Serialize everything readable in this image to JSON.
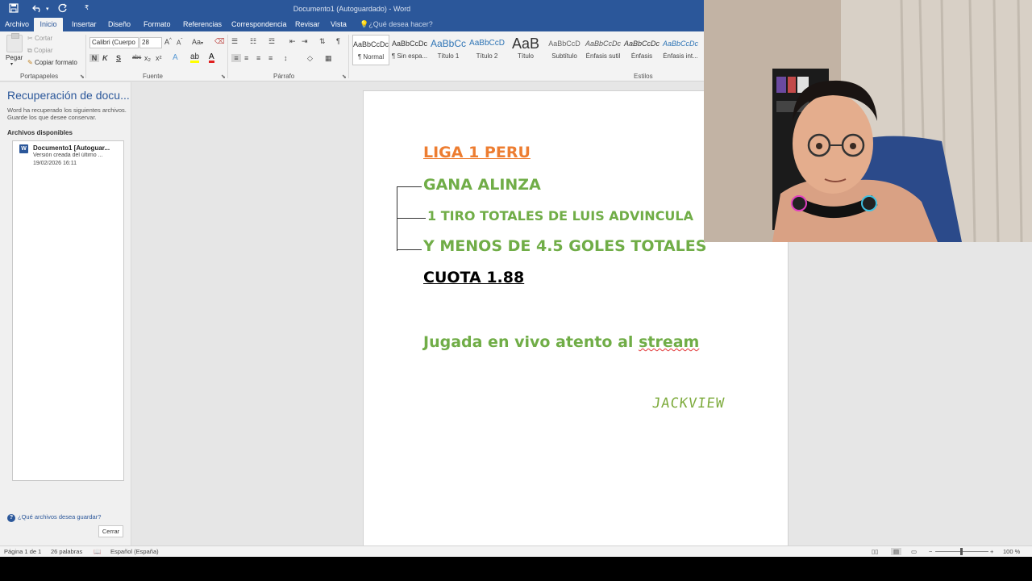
{
  "titlebar": {
    "title": "Documento1 (Autoguardado) - Word",
    "qa_save_icon": "save-icon",
    "qa_undo_icon": "undo-icon",
    "qa_redo_icon": "redo-icon",
    "qa_customize_icon": "customize-icon",
    "brand_color": "#2b579a"
  },
  "tabs": [
    {
      "label": "Archivo"
    },
    {
      "label": "Inicio",
      "active": true
    },
    {
      "label": "Insertar"
    },
    {
      "label": "Diseño"
    },
    {
      "label": "Formato"
    },
    {
      "label": "Referencias"
    },
    {
      "label": "Correspondencia"
    },
    {
      "label": "Revisar"
    },
    {
      "label": "Vista"
    }
  ],
  "tell_me": "¿Qué desea hacer?",
  "ribbon": {
    "clipboard": {
      "paste": "Pegar",
      "cut": "Cortar",
      "copy": "Copiar",
      "format_painter": "Copiar formato",
      "group": "Portapapeles"
    },
    "font": {
      "family": "Calibri (Cuerpo",
      "size": "28",
      "bold": "N",
      "italic": "K",
      "underline": "S",
      "strike": "abc",
      "subscript": "x₂",
      "superscript": "x²",
      "change_case": "Aa",
      "group": "Fuente"
    },
    "paragraph": {
      "group": "Párrafo"
    },
    "styles": {
      "items": [
        {
          "preview": "AaBbCcDc",
          "name": "¶ Normal",
          "selected": true
        },
        {
          "preview": "AaBbCcDc",
          "name": "¶ Sin espa..."
        },
        {
          "preview": "AaBbCc",
          "name": "Título 1"
        },
        {
          "preview": "AaBbCcD",
          "name": "Título 2"
        },
        {
          "preview": "AaB",
          "name": "Título"
        },
        {
          "preview": "AaBbCcD",
          "name": "Subtítulo"
        },
        {
          "preview": "AaBbCcDc",
          "name": "Énfasis sutil"
        },
        {
          "preview": "AaBbCcDc",
          "name": "Énfasis"
        },
        {
          "preview": "AaBbCcDc",
          "name": "Énfasis int..."
        }
      ],
      "group": "Estilos"
    }
  },
  "recovery": {
    "title": "Recuperación de docu...",
    "description": "Word ha recuperado los siguientes archivos. Guarde los que desee conservar.",
    "available": "Archivos disponibles",
    "file": {
      "name": "Documento1 [Autoguar...",
      "version": "Versión creada del último ...",
      "date": "19/02/2026 16:11"
    },
    "help_link": "¿Qué archivos desea guardar?",
    "close_button": "Cerrar"
  },
  "document": {
    "line1": "LIGA 1 PERU",
    "line2": "GANA ALINZA",
    "line3": "1 TIRO TOTALES DE LUIS ADVINCULA",
    "line4": "Y MENOS DE 4.5 GOLES TOTALES",
    "line5": "CUOTA 1.88",
    "line6_part1": "Jugada en vivo atento al ",
    "line6_part2": "stream",
    "signature": "JACKVIEW",
    "colors": {
      "orange": "#ed7d31",
      "green": "#70ad47",
      "black": "#000000"
    }
  },
  "statusbar": {
    "page": "Página 1 de 1",
    "words": "26 palabras",
    "language": "Español (España)",
    "zoom": "100 %"
  }
}
